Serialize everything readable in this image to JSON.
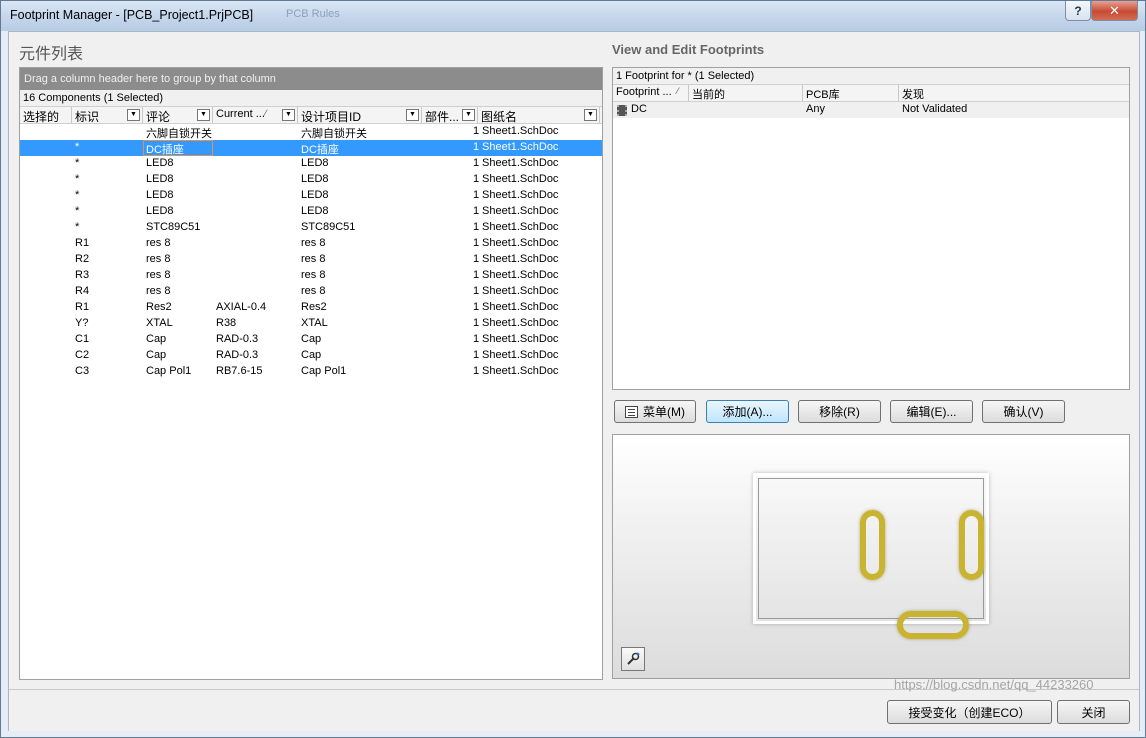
{
  "window": {
    "title": "Footprint Manager - [PCB_Project1.PrjPCB]",
    "ghost_title": "PCB Rules",
    "help_glyph": "?",
    "close_glyph": "✕"
  },
  "left": {
    "section_title": "元件列表",
    "group_hint": "Drag a column header here to group by that column",
    "count_text": "16 Components (1 Selected)",
    "columns": [
      "选择的",
      "标识",
      "评论",
      "Current ...",
      "设计项目ID",
      "部件...",
      "图纸名"
    ],
    "rows": [
      {
        "designator": "",
        "comment": "六脚自锁开关",
        "current": "",
        "design_id": "六脚自锁开关",
        "part": "1",
        "sheet": "Sheet1.SchDoc"
      },
      {
        "designator": "*",
        "comment": "DC插座",
        "current": "",
        "design_id": "DC插座",
        "part": "1",
        "sheet": "Sheet1.SchDoc",
        "selected": true
      },
      {
        "designator": "*",
        "comment": "LED8",
        "current": "",
        "design_id": "LED8",
        "part": "1",
        "sheet": "Sheet1.SchDoc"
      },
      {
        "designator": "*",
        "comment": "LED8",
        "current": "",
        "design_id": "LED8",
        "part": "1",
        "sheet": "Sheet1.SchDoc"
      },
      {
        "designator": "*",
        "comment": "LED8",
        "current": "",
        "design_id": "LED8",
        "part": "1",
        "sheet": "Sheet1.SchDoc"
      },
      {
        "designator": "*",
        "comment": "LED8",
        "current": "",
        "design_id": "LED8",
        "part": "1",
        "sheet": "Sheet1.SchDoc"
      },
      {
        "designator": "*",
        "comment": "STC89C51",
        "current": "",
        "design_id": "STC89C51",
        "part": "1",
        "sheet": "Sheet1.SchDoc"
      },
      {
        "designator": "R1",
        "comment": "res 8",
        "current": "",
        "design_id": "res 8",
        "part": "1",
        "sheet": "Sheet1.SchDoc"
      },
      {
        "designator": "R2",
        "comment": "res 8",
        "current": "",
        "design_id": "res 8",
        "part": "1",
        "sheet": "Sheet1.SchDoc"
      },
      {
        "designator": "R3",
        "comment": "res 8",
        "current": "",
        "design_id": "res 8",
        "part": "1",
        "sheet": "Sheet1.SchDoc"
      },
      {
        "designator": "R4",
        "comment": "res 8",
        "current": "",
        "design_id": "res 8",
        "part": "1",
        "sheet": "Sheet1.SchDoc"
      },
      {
        "designator": "R1",
        "comment": "Res2",
        "current": "AXIAL-0.4",
        "design_id": "Res2",
        "part": "1",
        "sheet": "Sheet1.SchDoc"
      },
      {
        "designator": "Y?",
        "comment": "XTAL",
        "current": "R38",
        "design_id": "XTAL",
        "part": "1",
        "sheet": "Sheet1.SchDoc"
      },
      {
        "designator": "C1",
        "comment": "Cap",
        "current": "RAD-0.3",
        "design_id": "Cap",
        "part": "1",
        "sheet": "Sheet1.SchDoc"
      },
      {
        "designator": "C2",
        "comment": "Cap",
        "current": "RAD-0.3",
        "design_id": "Cap",
        "part": "1",
        "sheet": "Sheet1.SchDoc"
      },
      {
        "designator": "C3",
        "comment": "Cap Pol1",
        "current": "RB7.6-15",
        "design_id": "Cap Pol1",
        "part": "1",
        "sheet": "Sheet1.SchDoc"
      }
    ]
  },
  "right": {
    "section_title": "View and Edit Footprints",
    "count_text": "1 Footprint for * (1 Selected)",
    "columns": [
      "Footprint ...",
      "当前的",
      "PCB库",
      "发现"
    ],
    "row": {
      "name": "DC",
      "current": "",
      "library": "Any",
      "found": "Not Validated"
    },
    "buttons": {
      "menu": "菜单(M)",
      "add": "添加(A)...",
      "remove": "移除(R)",
      "edit": "编辑(E)...",
      "confirm": "确认(V)"
    }
  },
  "footer": {
    "accept": "接受变化（创建ECO）",
    "close": "关闭",
    "watermark": "https://blog.csdn.net/qq_44233260"
  },
  "colors": {
    "selection": "#3399ff",
    "pad": "#c8b430"
  }
}
